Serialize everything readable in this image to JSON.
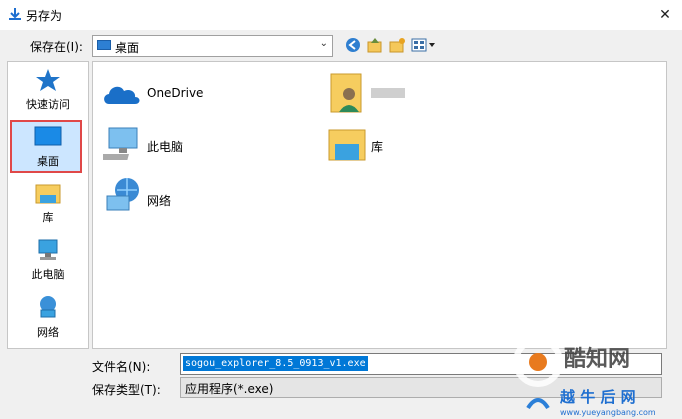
{
  "window": {
    "title": "另存为"
  },
  "location": {
    "label": "保存在(I):",
    "value": "桌面"
  },
  "sidebar": {
    "items": [
      {
        "label": "快速访问"
      },
      {
        "label": "桌面"
      },
      {
        "label": "库"
      },
      {
        "label": "此电脑"
      },
      {
        "label": "网络"
      }
    ]
  },
  "files": [
    {
      "label": "OneDrive"
    },
    {
      "label": "此电脑"
    },
    {
      "label": "网络"
    },
    {
      "label": ""
    },
    {
      "label": "库"
    }
  ],
  "filename": {
    "label": "文件名(N):",
    "value": "sogou_explorer_8.5_0913_v1.exe"
  },
  "filetype": {
    "label": "保存类型(T):",
    "value": "应用程序(*.exe)"
  },
  "watermark": {
    "brand": "酷知网",
    "site": "www.yueyangbang.com"
  },
  "colors": {
    "accent": "#0078d7",
    "highlight_border": "#e04848"
  }
}
